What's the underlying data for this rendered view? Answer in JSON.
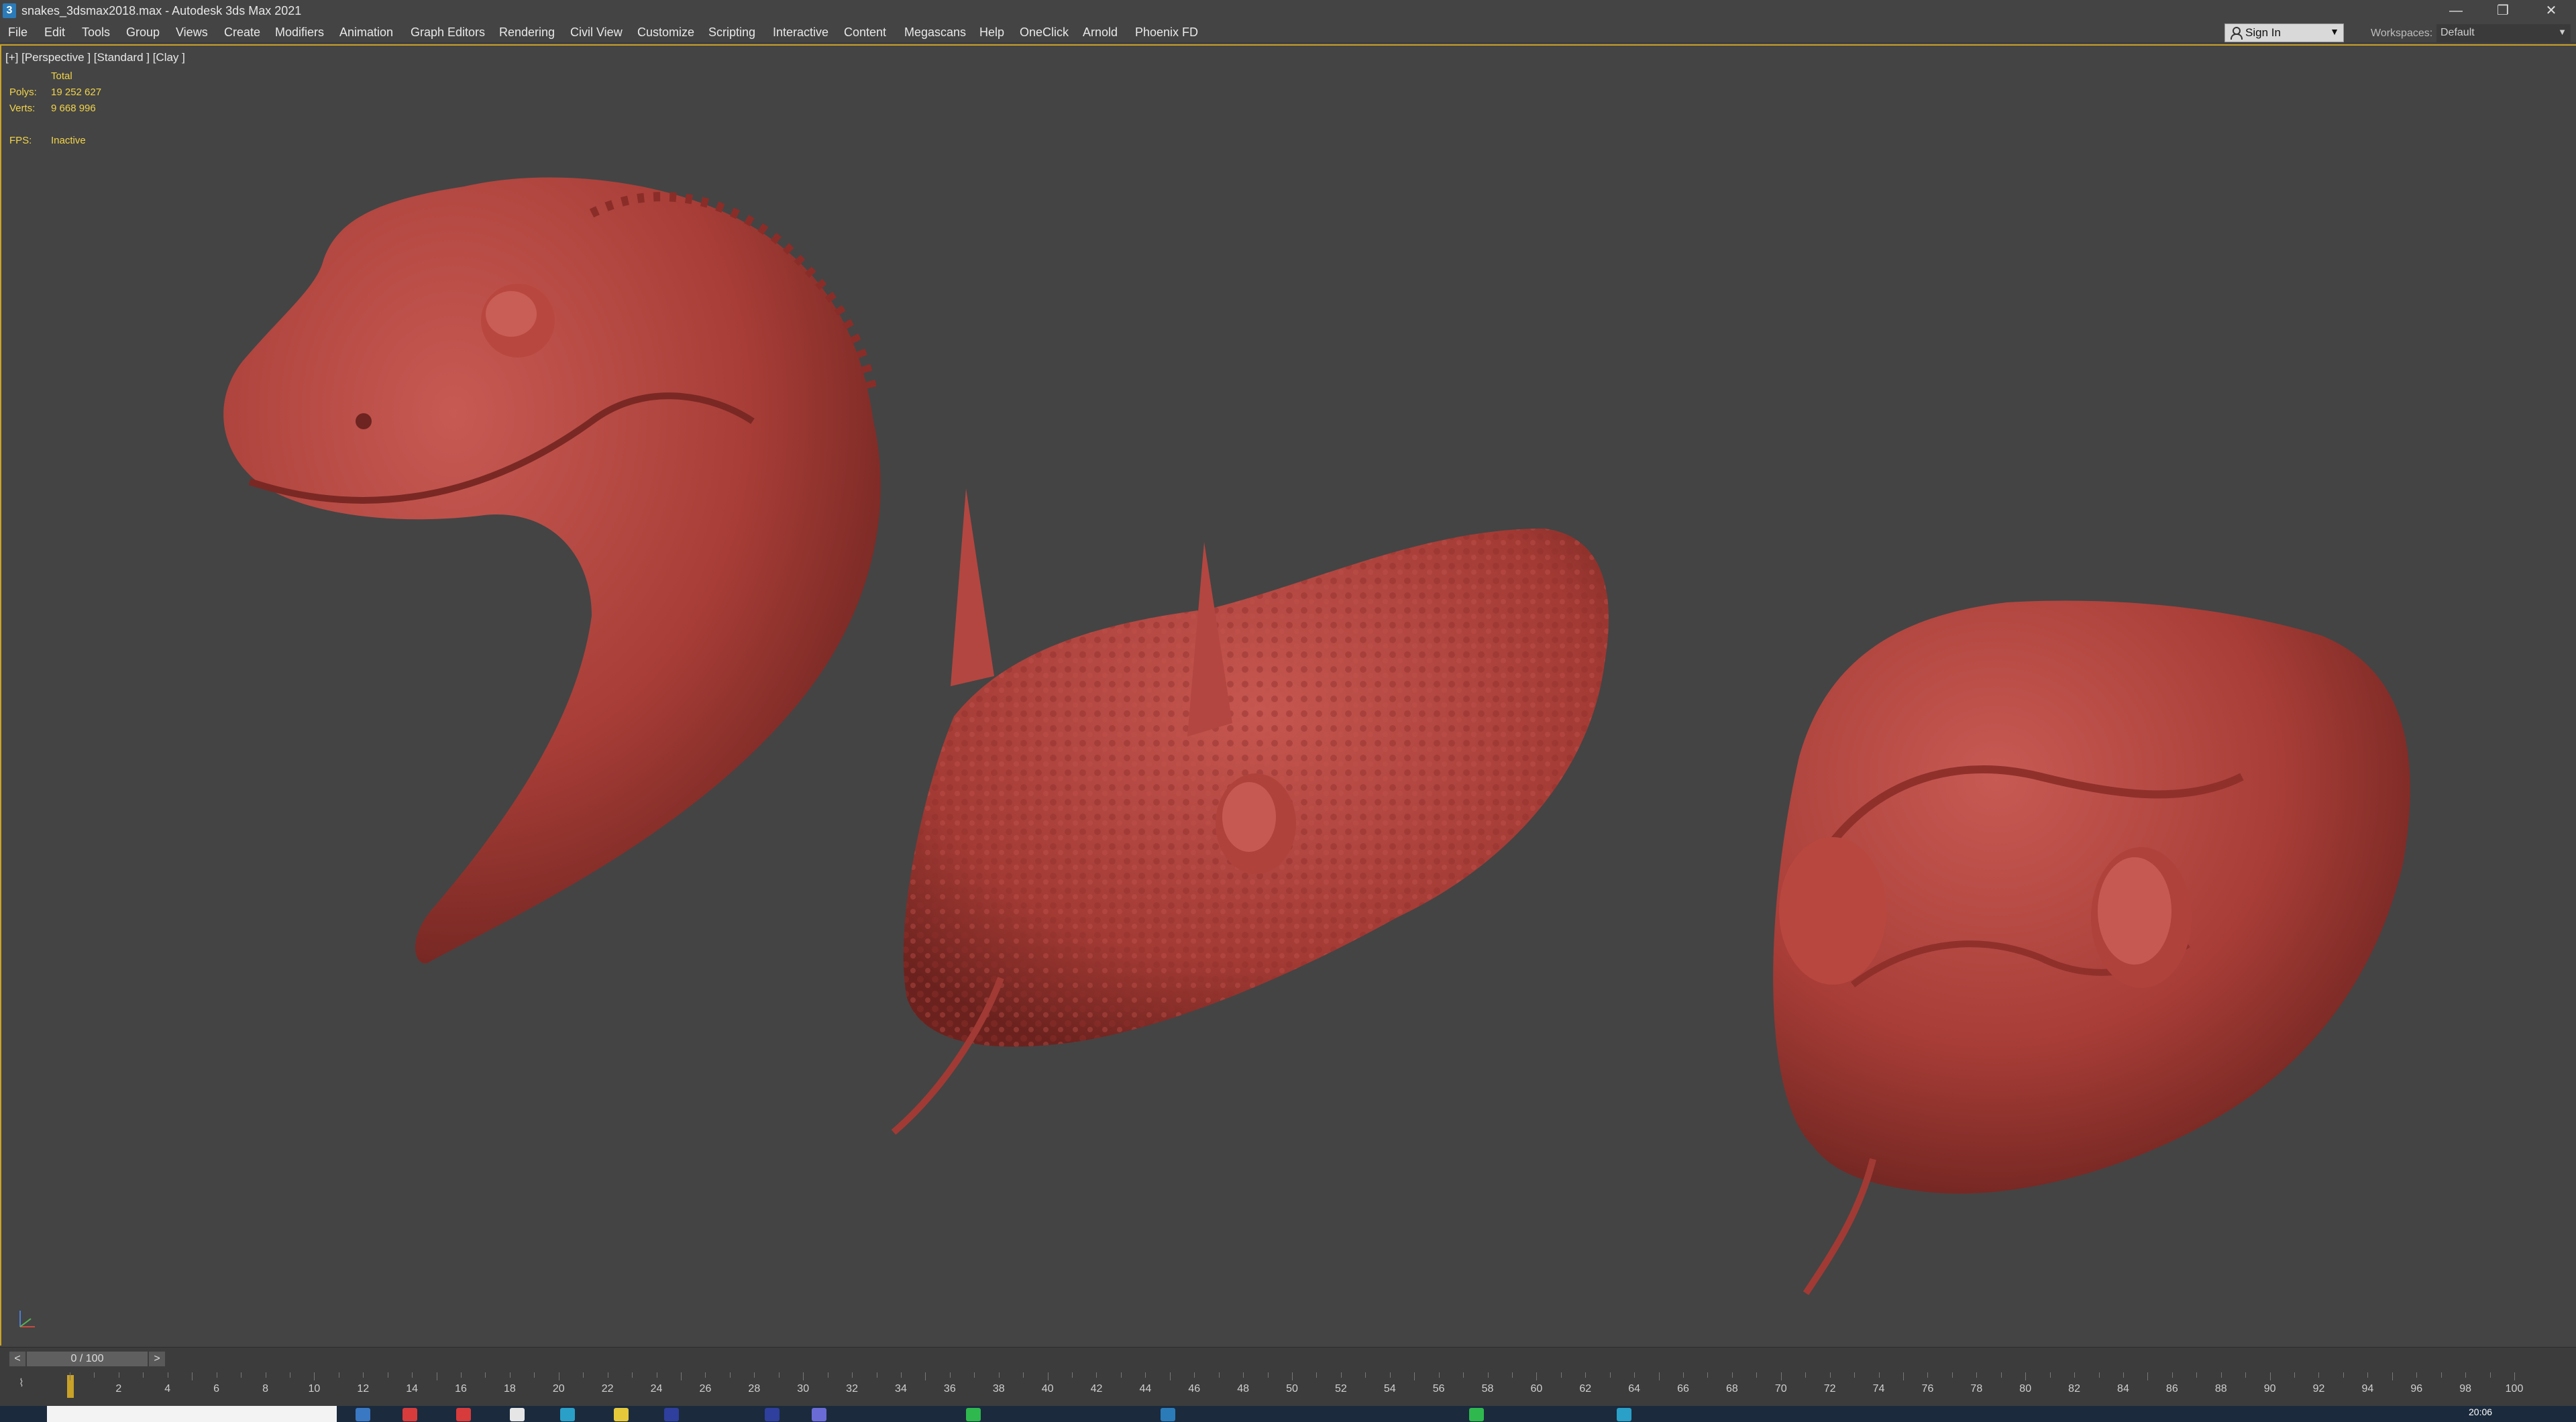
{
  "window": {
    "app_icon": "3",
    "title": "snakes_3dsmax2018.max - Autodesk 3ds Max 2021",
    "minimize": "—",
    "restore": "❐",
    "close": "✕"
  },
  "menu": {
    "items": [
      "File",
      "Edit",
      "Tools",
      "Group",
      "Views",
      "Create",
      "Modifiers",
      "Animation",
      "Graph Editors",
      "Rendering",
      "Civil View",
      "Customize",
      "Scripting",
      "Interactive",
      "Content",
      "Megascans",
      "Help",
      "OneClick",
      "Arnold",
      "Phoenix FD"
    ]
  },
  "account": {
    "signin_label": "Sign In",
    "workspaces_label": "Workspaces:",
    "workspace_value": "Default"
  },
  "viewport": {
    "label": "[+] [Perspective ] [Standard ] [Clay ]",
    "stats": {
      "total_label": "Total",
      "polys_label": "Polys:",
      "polys_value": "19 252 627",
      "verts_label": "Verts:",
      "verts_value": "9 668 996",
      "fps_label": "FPS:",
      "fps_value": "Inactive"
    },
    "clay_color": "#b5453f"
  },
  "timeline": {
    "frame_readout": "0 / 100",
    "prev": "<",
    "next": ">",
    "ticks": [
      "2",
      "4",
      "6",
      "8",
      "10",
      "12",
      "14",
      "16",
      "18",
      "20",
      "22",
      "24",
      "26",
      "28",
      "30",
      "32",
      "34",
      "36",
      "38",
      "40",
      "42",
      "44",
      "46",
      "48",
      "50",
      "52",
      "54",
      "56",
      "58",
      "60",
      "62",
      "64",
      "66",
      "68",
      "70",
      "72",
      "74",
      "76",
      "78",
      "80",
      "82",
      "84",
      "86",
      "88",
      "90",
      "92",
      "94",
      "96",
      "98",
      "100"
    ]
  },
  "taskbar": {
    "clock": "20:06"
  }
}
